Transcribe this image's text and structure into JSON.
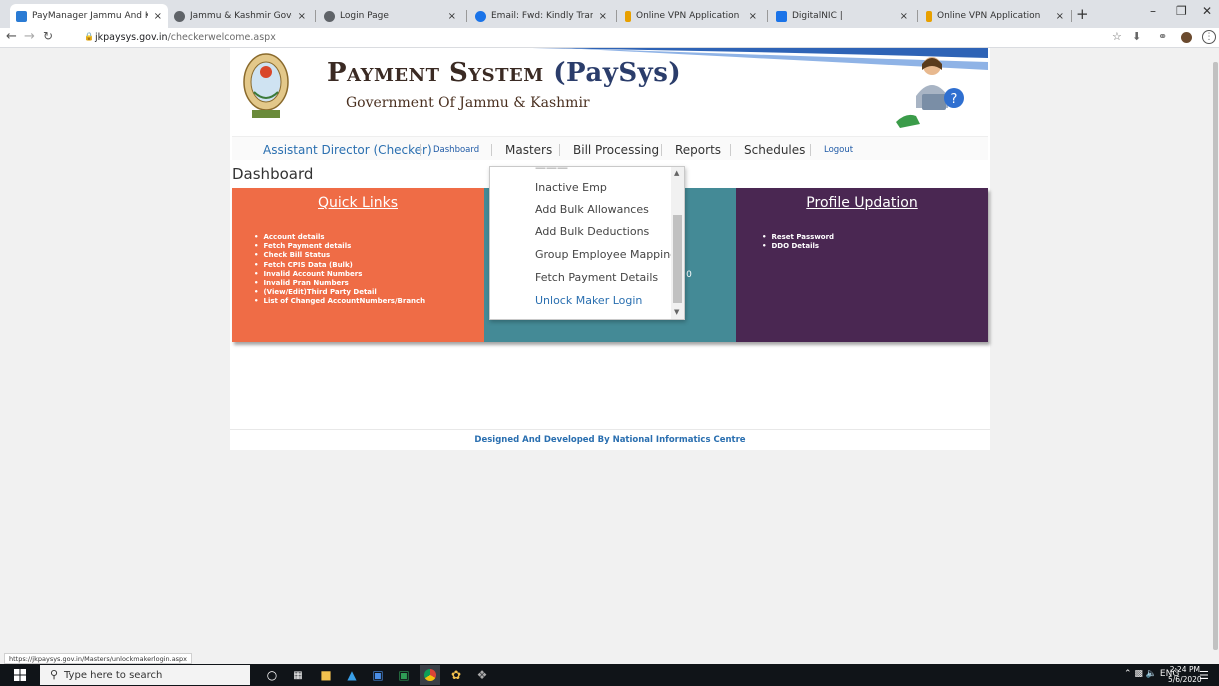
{
  "browser": {
    "tabs": [
      {
        "title": "PayManager Jammu And Kashmi",
        "favicon_color": "#2a7bd4",
        "active": true
      },
      {
        "title": "Jammu & Kashmir Government",
        "favicon_color": "#5f6368",
        "active": false
      },
      {
        "title": "Login Page",
        "favicon_color": "#5f6368",
        "active": false
      },
      {
        "title": "Email: Fwd: Kindly Transfer Paysy",
        "favicon_color": "#1a73e8",
        "active": false
      },
      {
        "title": "Online VPN Application",
        "favicon_color": "#e8a000",
        "active": false
      },
      {
        "title": "DigitalNIC |",
        "favicon_color": "#1a73e8",
        "active": false
      },
      {
        "title": "Online VPN Application",
        "favicon_color": "#e8a000",
        "active": false
      }
    ],
    "close_glyph": "×",
    "new_tab_glyph": "+",
    "url_host": "jkpaysys.gov.in",
    "url_path": "/checkerwelcome.aspx",
    "status_url": "https://jkpaysys.gov.in/Masters/unlockmakerlogin.aspx"
  },
  "header": {
    "title_main": "Payment System",
    "title_abbr": "(PaySys)",
    "subtitle": "Government Of Jammu & Kashmir"
  },
  "menu": {
    "role": "Assistant Director (Checker)",
    "dashboard": "Dashboard",
    "masters": "Masters",
    "bill_processing": "Bill Processing",
    "reports": "Reports",
    "schedules": "Schedules",
    "logout": "Logout"
  },
  "page": {
    "title": "Dashboard"
  },
  "panels": {
    "quick_links": {
      "heading": "Quick Links",
      "color": "#ef6c46",
      "items": [
        "Account details",
        "Fetch Payment details",
        "Check Bill Status",
        "Fetch CPIS Data (Bulk)",
        "Invalid Account Numbers",
        "Invalid Pran Numbers",
        "(View/Edit)Third Party Detail",
        "List of Changed AccountNumbers/Branch"
      ]
    },
    "middle": {
      "color": "#448a96",
      "value": "- 0"
    },
    "profile": {
      "heading": "Profile Updation",
      "color": "#4a2752",
      "items": [
        "Reset Password",
        "DDO Details"
      ]
    }
  },
  "dropdown": {
    "items": [
      "Inactive Emp",
      "Add Bulk Allowances",
      "Add Bulk Deductions",
      "Group Employee Mapping",
      "Fetch Payment Details",
      "Unlock Maker Login"
    ],
    "highlighted": "Unlock Maker Login"
  },
  "footer": {
    "text": "Designed And Developed By National Informatics Centre"
  },
  "taskbar": {
    "search_placeholder": "Type here to search",
    "tray_lang": "ENG",
    "time": "2:24 PM",
    "date": "5/6/2020"
  }
}
